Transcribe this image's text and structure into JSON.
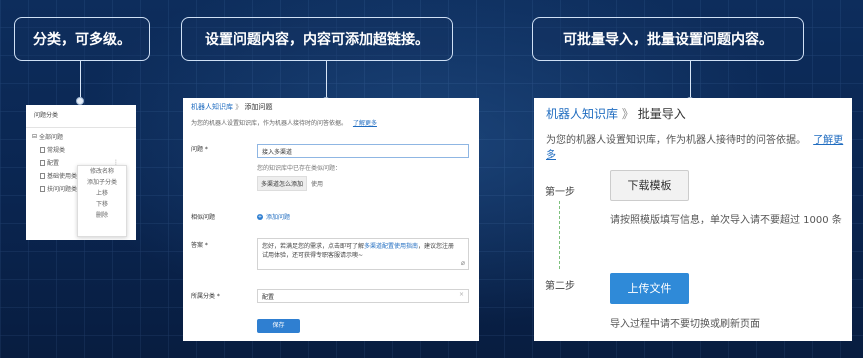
{
  "callouts": {
    "c1": "分类，可多级。",
    "c2": "设置问题内容，内容可添加超链接。",
    "c3": "可批量导入，批量设置问题内容。"
  },
  "panel1": {
    "header": "问题分类",
    "tree": [
      "全部问题",
      "常规类",
      "配置",
      "基础使用类",
      "扶问问题类"
    ],
    "context_menu": [
      "修改名称",
      "添加子分类",
      "上移",
      "下移",
      "删除"
    ]
  },
  "panel2": {
    "breadcrumb_brand": "机器人知识库",
    "breadcrumb_sep": "》",
    "breadcrumb_page": "添加问题",
    "intro": "为您的机器人设置知识库，作为机器人接待时的问答依据。",
    "learn_more": "了解更多",
    "question_label": "问题 *",
    "question_value": "接入多渠道",
    "question_hint": "您的知识库中已存在类似问题：",
    "similar_tag": "多渠道怎么添加",
    "similar_tag_action": "使用",
    "similar_label": "相似问题",
    "add_similar": "添加问题",
    "answer_label": "答案 *",
    "answer_text_1": "您好，若满足您的需求，点击即可了解",
    "answer_link": "多渠道配置使用指南",
    "answer_text_2": "，建议您注册试用体验，还可获得专职客服请示噢~",
    "category_label": "所属分类 *",
    "category_value": "配置",
    "save": "保存"
  },
  "panel3": {
    "brand": "机器人知识库",
    "sep": "》",
    "page": "批量导入",
    "intro": "为您的机器人设置知识库，作为机器人接待时的问答依据。",
    "learn_more": "了解更多",
    "step1": "第一步",
    "download_button": "下载模板",
    "step1_hint": "请按照模版填写信息，单次导入请不要超过 1000 条",
    "step2": "第二步",
    "upload_button": "上传文件",
    "step2_hint": "导入过程中请不要切换或刷新页面"
  }
}
